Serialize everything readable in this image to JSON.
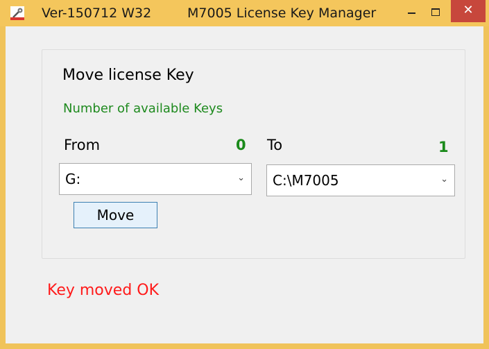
{
  "window": {
    "title_version": "Ver-150712 W32",
    "title_name": "M7005 License Key Manager",
    "close_glyph": "✕",
    "accent_color": "#f4c65c",
    "close_color": "#c7473c"
  },
  "group": {
    "title": "Move license Key",
    "available_label": "Number of available Keys",
    "from_label": "From",
    "from_count": "0",
    "to_label": "To",
    "to_count": "1",
    "from_selected": "G:",
    "to_selected": "C:\\M7005",
    "move_label": "Move"
  },
  "status": {
    "message": "Key moved OK",
    "color": "#ff1a1a"
  },
  "icons": {
    "app": "key-tool-icon",
    "combo_arrow": "chevron-down-icon"
  }
}
